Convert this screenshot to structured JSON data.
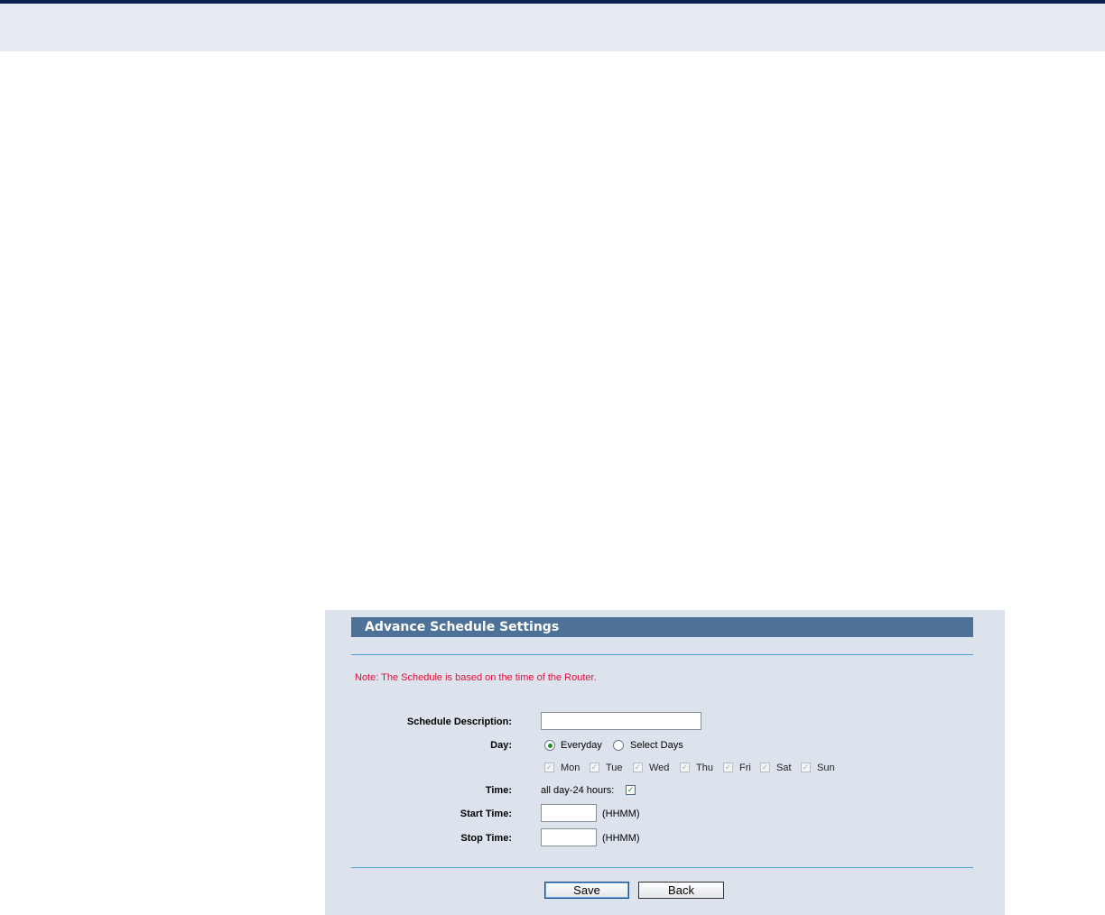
{
  "form": {
    "title": "Advance Schedule Settings",
    "note": "Note: The Schedule is based on the time of the Router.",
    "description_label": "Schedule Description:",
    "description_value": "",
    "day_label": "Day:",
    "day_options": {
      "everyday": "Everyday",
      "select_days": "Select Days"
    },
    "day_selected": "Everyday",
    "days": [
      "Mon",
      "Tue",
      "Wed",
      "Thu",
      "Fri",
      "Sat",
      "Sun"
    ],
    "time_label": "Time:",
    "allday_label": "all day-24 hours:",
    "allday_checked": true,
    "start_label": "Start Time:",
    "start_value": "",
    "stop_label": "Stop Time:",
    "stop_value": "",
    "time_format_hint": "(HHMM)"
  },
  "buttons": {
    "save": "Save",
    "back": "Back"
  },
  "colors": {
    "header_bar": "#4e7297",
    "note": "#e0103c",
    "rule": "#4aa3d6",
    "panel": "#dde3ec"
  }
}
